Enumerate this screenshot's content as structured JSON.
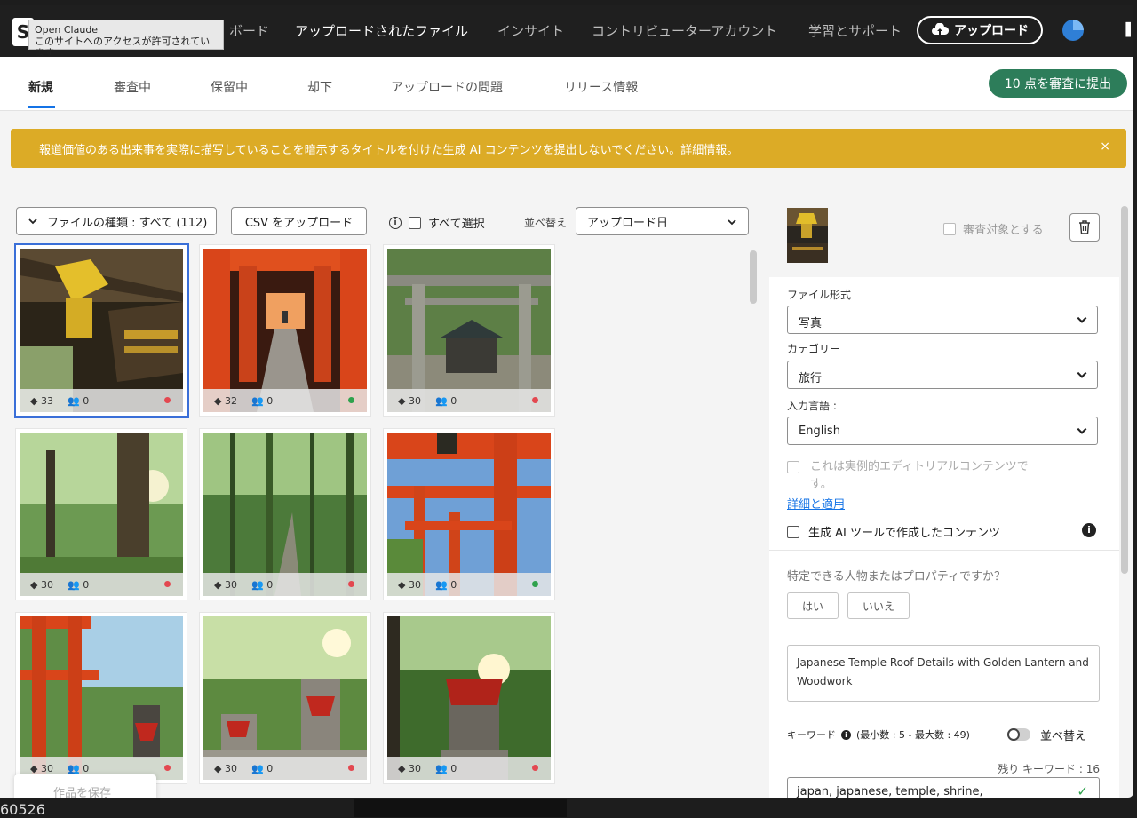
{
  "tooltip": {
    "line1": "Open Claude",
    "line2": "このサイトへのアクセスが許可されています"
  },
  "logo": "S",
  "nav": {
    "items": [
      {
        "label": "ボード",
        "active": false
      },
      {
        "label": "アップロードされたファイル",
        "active": true
      },
      {
        "label": "インサイト",
        "active": false
      },
      {
        "label": "コントリビューターアカウント",
        "active": false
      },
      {
        "label": "学習とサポート",
        "active": false
      }
    ],
    "upload_label": "アップロード"
  },
  "tabs": [
    "新規",
    "審査中",
    "保留中",
    "却下",
    "アップロードの問題",
    "リリース情報"
  ],
  "submit_label": "10 点を審査に提出",
  "banner": {
    "text": "報道価値のある出来事を実際に描写していることを暗示するタイトルを付けた生成 AI コンテンツを提出しないでください。",
    "link": "詳細情報",
    "suffix": "。",
    "close": "×"
  },
  "toolbar": {
    "file_type_filter": "ファイルの種類 : すべて (112)",
    "csv_upload": "CSV をアップロード",
    "select_all": "すべて選択",
    "sort_label": "並べ替え",
    "sort_value": "アップロード日"
  },
  "grid": [
    {
      "keywords": "33",
      "releases": "0",
      "status": "red",
      "selected": true,
      "scene": "temple"
    },
    {
      "keywords": "32",
      "releases": "0",
      "status": "green",
      "selected": false,
      "scene": "torii-tunnel"
    },
    {
      "keywords": "30",
      "releases": "0",
      "status": "red",
      "selected": false,
      "scene": "stone-torii"
    },
    {
      "keywords": "30",
      "releases": "0",
      "status": "red",
      "selected": false,
      "scene": "forest"
    },
    {
      "keywords": "30",
      "releases": "0",
      "status": "red",
      "selected": false,
      "scene": "bamboo"
    },
    {
      "keywords": "30",
      "releases": "0",
      "status": "green",
      "selected": false,
      "scene": "torii-up"
    },
    {
      "keywords": "30",
      "releases": "0",
      "status": "red",
      "selected": false,
      "scene": "torii-fox"
    },
    {
      "keywords": "30",
      "releases": "0",
      "status": "red",
      "selected": false,
      "scene": "fox-statues"
    },
    {
      "keywords": "30",
      "releases": "0",
      "status": "red",
      "selected": false,
      "scene": "fox-shrine"
    }
  ],
  "save_label": "作品を保存",
  "panel": {
    "review_target": "審査対象とする",
    "file_format_label": "ファイル形式",
    "file_format_value": "写真",
    "category_label": "カテゴリー",
    "category_value": "旅行",
    "language_label": "入力言語 :",
    "language_value": "English",
    "editorial_line1": "これは実例的エディトリアルコンテンツで",
    "editorial_line2": "す。",
    "details_link": "詳細と適用",
    "genai_label": "生成 AI ツールで作成したコンテンツ",
    "property_question": "特定できる人物またはプロパティですか？",
    "yes": "はい",
    "no": "いいえ",
    "title_value": "Japanese Temple Roof Details with Golden Lantern and Woodwork",
    "keywords_label": "キーワード",
    "keywords_range": "(最小数 : 5 - 最大数 : 49)",
    "sort_toggle_label": "並べ替え",
    "remaining_label": "残り キーワード : 16",
    "keywords_value": "japan, japanese, temple, shrine,"
  },
  "bottom_text": "60526",
  "colors": {
    "accent": "#1473e6",
    "submit": "#2d7d5a",
    "banner": "#dcab26",
    "status_red": "#e34850",
    "status_green": "#2fa24d"
  }
}
